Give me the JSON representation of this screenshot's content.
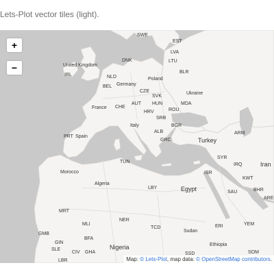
{
  "title": "Lets-Plot vector tiles (light).",
  "controls": {
    "zoom_in": "+",
    "zoom_out": "−"
  },
  "attribution": {
    "prefix": "Map: ",
    "lets_plot_link": "© Lets-Plot",
    "middle": ", map data: ",
    "osm_link": "© OpenStreetMap contributors",
    "suffix": "."
  },
  "colors": {
    "water": "#c9c9c9",
    "land": "#f5f4f2",
    "border": "#d4d2cf",
    "label": "#333333",
    "attribution_link": "#2e6fd8"
  },
  "labels": [
    {
      "text": "SWE",
      "size": "small"
    },
    {
      "text": "EST",
      "size": "small"
    },
    {
      "text": "LVA",
      "size": "small"
    },
    {
      "text": "DNK",
      "size": "small"
    },
    {
      "text": "LTU",
      "size": "small"
    },
    {
      "text": "United Kingdom",
      "size": "small"
    },
    {
      "text": "IRL",
      "size": "small"
    },
    {
      "text": "BLR",
      "size": "small"
    },
    {
      "text": "NLD",
      "size": "small"
    },
    {
      "text": "Poland",
      "size": "small"
    },
    {
      "text": "BEL",
      "size": "small"
    },
    {
      "text": "Germany",
      "size": "small"
    },
    {
      "text": "CZE",
      "size": "small"
    },
    {
      "text": "SVK",
      "size": "small"
    },
    {
      "text": "Ukraine",
      "size": "small"
    },
    {
      "text": "AUT",
      "size": "small"
    },
    {
      "text": "HUN",
      "size": "small"
    },
    {
      "text": "MDA",
      "size": "small"
    },
    {
      "text": "France",
      "size": "small"
    },
    {
      "text": "CHE",
      "size": "small"
    },
    {
      "text": "HRV",
      "size": "small"
    },
    {
      "text": "ROU",
      "size": "small"
    },
    {
      "text": "SRB",
      "size": "small"
    },
    {
      "text": "Italy",
      "size": "small"
    },
    {
      "text": "BGR",
      "size": "small"
    },
    {
      "text": "ALB",
      "size": "small"
    },
    {
      "text": "PRT",
      "size": "small"
    },
    {
      "text": "Spain",
      "size": "small"
    },
    {
      "text": "GRC",
      "size": "small"
    },
    {
      "text": "Turkey",
      "size": "large"
    },
    {
      "text": "ARM",
      "size": "small"
    },
    {
      "text": "TUN",
      "size": "small"
    },
    {
      "text": "SYR",
      "size": "small"
    },
    {
      "text": "IRQ",
      "size": "small"
    },
    {
      "text": "Iran",
      "size": "large"
    },
    {
      "text": "Morocco",
      "size": "small"
    },
    {
      "text": "ISR",
      "size": "small"
    },
    {
      "text": "KWT",
      "size": "small"
    },
    {
      "text": "Algeria",
      "size": "small"
    },
    {
      "text": "LBY",
      "size": "small"
    },
    {
      "text": "Egypt",
      "size": "large"
    },
    {
      "text": "SAU",
      "size": "small"
    },
    {
      "text": "BHR",
      "size": "small"
    },
    {
      "text": "ARE",
      "size": "small"
    },
    {
      "text": "MRT",
      "size": "small"
    },
    {
      "text": "NER",
      "size": "small"
    },
    {
      "text": "MLI",
      "size": "small"
    },
    {
      "text": "TCD",
      "size": "small"
    },
    {
      "text": "Sudan",
      "size": "small"
    },
    {
      "text": "ERI",
      "size": "small"
    },
    {
      "text": "YEM",
      "size": "small"
    },
    {
      "text": "GMB",
      "size": "small"
    },
    {
      "text": "BFA",
      "size": "small"
    },
    {
      "text": "GIN",
      "size": "small"
    },
    {
      "text": "SLE",
      "size": "small"
    },
    {
      "text": "CIV",
      "size": "small"
    },
    {
      "text": "GHA",
      "size": "small"
    },
    {
      "text": "Nigeria",
      "size": "large"
    },
    {
      "text": "Ethiopia",
      "size": "small"
    },
    {
      "text": "LBR",
      "size": "small"
    },
    {
      "text": "SSD",
      "size": "small"
    },
    {
      "text": "SOM",
      "size": "small"
    }
  ]
}
